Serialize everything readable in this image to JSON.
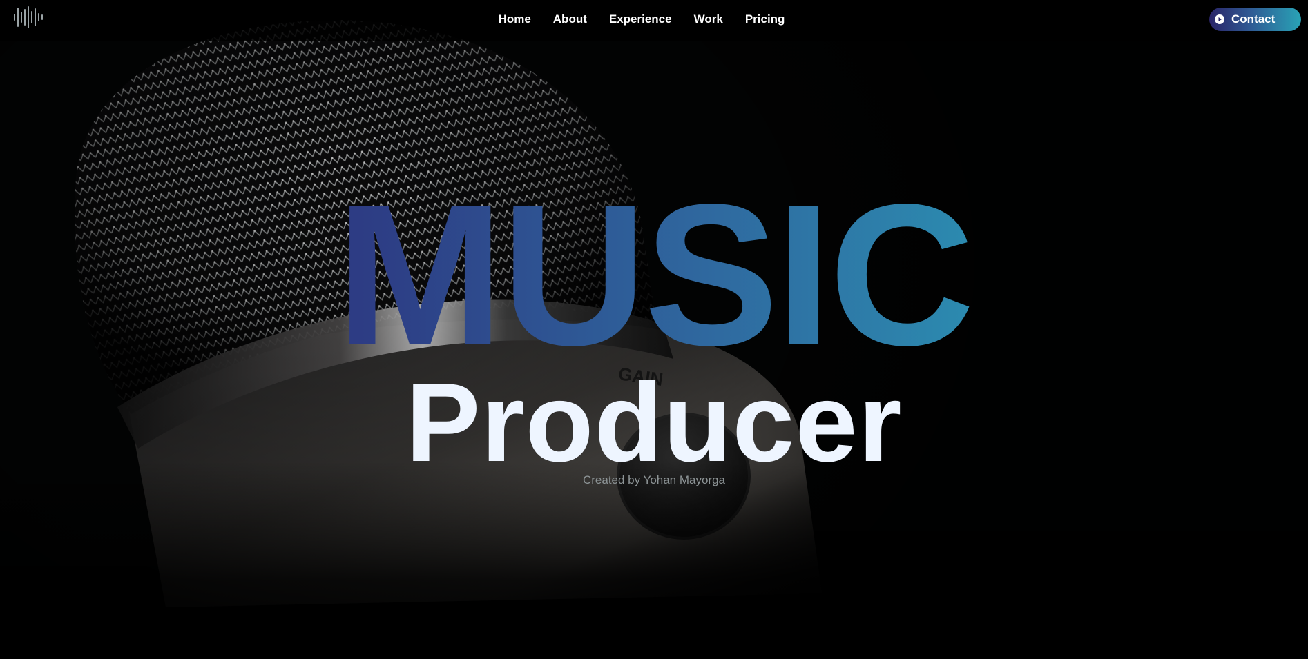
{
  "nav": {
    "logo_icon": "soundwave-logo-icon",
    "links": [
      {
        "label": "Home"
      },
      {
        "label": "About"
      },
      {
        "label": "Experience"
      },
      {
        "label": "Work"
      },
      {
        "label": "Pricing"
      }
    ],
    "contact": {
      "label": "Contact",
      "icon": "play-circle-icon"
    }
  },
  "hero": {
    "title": "MUSIC",
    "subtitle": "Producer",
    "credit": "Created by Yohan Mayorga",
    "background_image": "microphone-photo",
    "knob_label": "GAIN"
  },
  "colors": {
    "gradient_start": "#2b1f6e",
    "gradient_mid": "#2f6aa0",
    "gradient_end": "#2aa6ba",
    "subtitle": "#eef5ff",
    "credit": "#8d9496",
    "nav_border": "#1f4a52",
    "background": "#030404"
  }
}
